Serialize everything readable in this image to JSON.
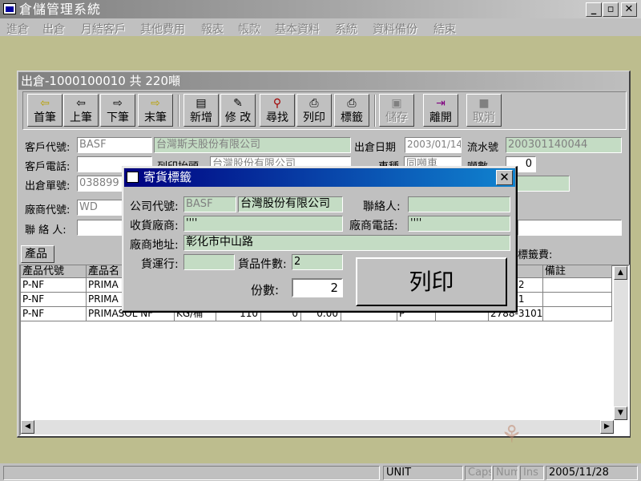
{
  "app": {
    "title": "倉儲管理系統",
    "btn_min": "_",
    "btn_restore": "▫",
    "btn_close": "✕"
  },
  "menu": [
    "進倉",
    "出倉",
    "月結客戶",
    "其他費用",
    "報表",
    "帳款",
    "基本資料",
    "系統",
    "資料備份",
    "結束"
  ],
  "form": {
    "title": "出倉-1000100010 共 220噸"
  },
  "toolbar": {
    "first": {
      "icon": "⇦",
      "label": "首筆"
    },
    "prev": {
      "icon": "⇦",
      "label": "上筆"
    },
    "next": {
      "icon": "⇨",
      "label": "下筆"
    },
    "last": {
      "icon": "⇨",
      "label": "末筆"
    },
    "add": {
      "icon": "▤",
      "label": "新增"
    },
    "edit": {
      "icon": "✎",
      "label": "修 改"
    },
    "find": {
      "icon": "⚲",
      "label": "尋找"
    },
    "print": {
      "icon": "⎙",
      "label": "列印"
    },
    "label": {
      "icon": "⎙",
      "label": "標籤"
    },
    "save": {
      "icon": "▣",
      "label": "儲存"
    },
    "exit": {
      "icon": "⇥",
      "label": "離開"
    },
    "cancel": {
      "icon": "■",
      "label": "取消"
    }
  },
  "fields": {
    "customer_code_label": "客戶代號:",
    "customer_code": "BASF",
    "customer_name": "台灣斯夫股份有限公司",
    "ship_date_label": "出倉日期",
    "ship_date": "2003/01/14",
    "serial_label": "流水號",
    "serial": "200301140044",
    "customer_phone_label": "客戶電話:",
    "print_header_label": "列印抬頭",
    "print_header": "台灣股份有限公司",
    "vehicle_label": "車種",
    "vehicle": "同噸車",
    "tonnage_label": "噸數",
    "tonnage": "0",
    "out_no_label": "出倉單號:",
    "out_no": "038899",
    "vendor_code_label": "廠商代號:",
    "vendor_code": "WD",
    "contact_label": "聯 絡 人:",
    "label_fee_label": "標籤費:"
  },
  "tabs": {
    "products": "產品"
  },
  "grid": {
    "headers": [
      "產品代號",
      "產品名",
      "",
      "",
      "",
      "",
      "",
      "",
      "",
      "備註"
    ],
    "rows": [
      {
        "code": "P-NF",
        "name": "PRIMA",
        "c3": "",
        "c4": "",
        "c5": "",
        "c6": "",
        "c7": "",
        "c8": "",
        "c9": "2-2102",
        "note": ""
      },
      {
        "code": "P-NF",
        "name": "PRIMA",
        "c3": "",
        "c4": "",
        "c5": "",
        "c6": "",
        "c7": "",
        "c8": "",
        "c9": "2-2111",
        "note": ""
      },
      {
        "code": "P-NF",
        "name": "PRIMASOL   NF",
        "c3": "KG/桶",
        "c4": "110",
        "c5": "0",
        "c6": "0.00",
        "c7": "P",
        "c8": "",
        "c9": "2788-3101",
        "note": ""
      }
    ]
  },
  "dialog": {
    "title": "寄貨標籤",
    "close": "✕",
    "company_code_label": "公司代號:",
    "company_code": "BASF",
    "company_name": "台灣股份有限公司",
    "contact_label": "聯絡人:",
    "contact": "",
    "receiver_label": "收貨廠商:",
    "receiver": "''''",
    "vendor_phone_label": "廠商電話:",
    "vendor_phone": "''''",
    "vendor_addr_label": "廠商地址:",
    "vendor_addr": "彰化市中山路",
    "carrier_label": "貨運行:",
    "carrier": "",
    "pieces_label": "貨品件數:",
    "pieces": "2",
    "copies_label": "份數:",
    "copies": "2",
    "print_button": "列印"
  },
  "status": {
    "unit": "UNIT",
    "caps": "Caps",
    "num": "Num",
    "ins": "Ins",
    "date": "2005/11/28"
  }
}
